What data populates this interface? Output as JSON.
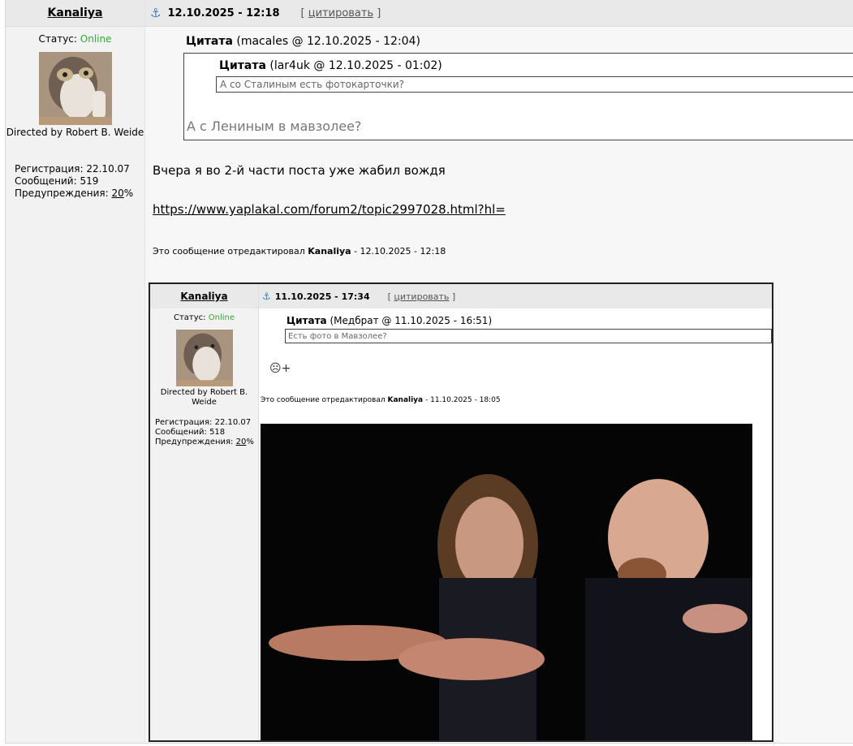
{
  "post": {
    "author": "Kanaliya",
    "status_label": "Статус:",
    "status_value": "Online",
    "tagline": "Directed by Robert B. Weide",
    "stats": {
      "reg_label": "Регистрация:",
      "reg_value": "22.10.07",
      "msgs_label": "Сообщений:",
      "msgs_value": "519",
      "warn_label": "Предупреждения:",
      "warn_value": "20",
      "warn_unit": "%"
    },
    "date": "12.10.2025 - 12:18",
    "cite_open": "[",
    "cite_label": "цитировать",
    "cite_close": "]",
    "quote1_label": "Цитата",
    "quote1_meta": "(macales @ 12.10.2025 - 12:04)",
    "quote2_label": "Цитата",
    "quote2_meta": "(lar4uk @ 12.10.2025 - 01:02)",
    "quote2_text": "А со Сталиным есть фотокарточки?",
    "quote1_text": "А с Лениным в мавзолее?",
    "message": "Вчера я во 2-й части поста уже жабил вождя",
    "link": "https://www.yaplakal.com/forum2/topic2997028.html?hl=",
    "edited_prefix": "Это сообщение отредактировал",
    "edited_by": "Kanaliya",
    "edited_time": "- 12.10.2025 - 12:18"
  },
  "screenshot": {
    "author": "Kanaliya",
    "status_label": "Статус:",
    "status_value": "Online",
    "tagline": "Directed by Robert B. Weide",
    "reg_label": "Регистрация:",
    "reg_value": "22.10.07",
    "msgs_label": "Сообщений:",
    "msgs_value": "518",
    "warn_label": "Предупреждения:",
    "warn_value": "20",
    "warn_unit": "%",
    "date": "11.10.2025 - 17:34",
    "cite_open": "[",
    "cite_label": "цитировать",
    "cite_close": "]",
    "quote_label": "Цитата",
    "quote_meta": "(Медбрат @ 11.10.2025 - 16:51)",
    "quote_text": "Есть фото в Мавзолее?",
    "emoji": "☹+",
    "edited_prefix": "Это сообщение отредактировал",
    "edited_by": "Kanaliya",
    "edited_time": "- 11.10.2025 - 18:05"
  },
  "colors": {
    "online": "#33aa33",
    "anchor": "#3b7bbf",
    "header_bg": "#e9e9e9"
  }
}
